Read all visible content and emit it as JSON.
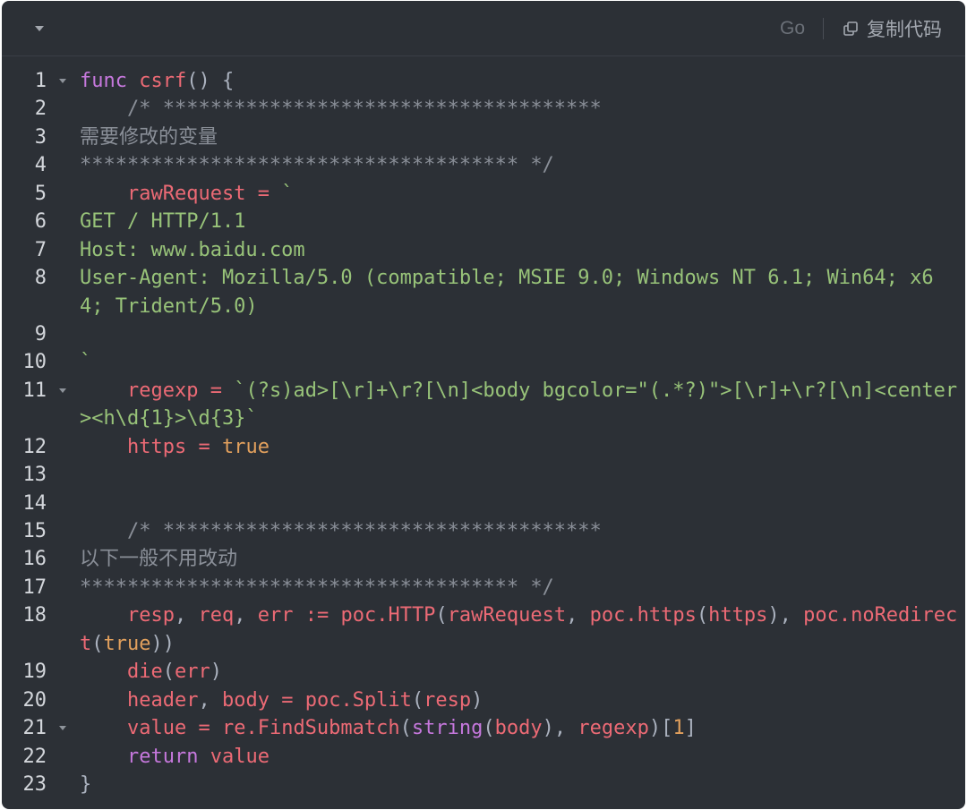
{
  "toolbar": {
    "collapse_icon": "chevron-down-icon",
    "language": "Go",
    "copy_icon": "copy-icon",
    "copy_label": "复制代码"
  },
  "fold_icon": "caret-down-icon",
  "colors": {
    "background": "#2c3036",
    "line_number": "#d3d6db",
    "fold_caret": "#8e939b"
  },
  "syntax_colors": {
    "keyword": "#c678dd",
    "builtin": "#c678dd",
    "identifier": "#ec6a75",
    "operator": "#ec6a75",
    "string": "#98c379",
    "comment": "#8a8f98",
    "punctuation": "#abb2bf",
    "literal": "#e2a05d",
    "plain": "#abb2bf"
  },
  "code": {
    "lines": [
      {
        "n": 1,
        "fold": true,
        "rows": [
          [
            {
              "keyword": "func"
            },
            {
              "plain": " "
            },
            {
              "identifier": "csrf"
            },
            {
              "punctuation": "() {"
            }
          ]
        ]
      },
      {
        "n": 2,
        "fold": false,
        "rows": [
          [
            {
              "comment": "    /* *************************************"
            }
          ]
        ]
      },
      {
        "n": 3,
        "fold": false,
        "rows": [
          [
            {
              "comment": "需要修改的变量"
            }
          ]
        ]
      },
      {
        "n": 4,
        "fold": false,
        "rows": [
          [
            {
              "comment": "************************************* */"
            }
          ]
        ]
      },
      {
        "n": 5,
        "fold": false,
        "rows": [
          [
            {
              "plain": "    "
            },
            {
              "identifier": "rawRequest"
            },
            {
              "plain": " "
            },
            {
              "operator": "="
            },
            {
              "plain": " "
            },
            {
              "string": "`"
            }
          ]
        ]
      },
      {
        "n": 6,
        "fold": false,
        "rows": [
          [
            {
              "string": "GET / HTTP/1.1"
            }
          ]
        ]
      },
      {
        "n": 7,
        "fold": false,
        "rows": [
          [
            {
              "string": "Host: www.baidu.com"
            }
          ]
        ]
      },
      {
        "n": 8,
        "fold": false,
        "rows": [
          [
            {
              "string": "User-Agent: Mozilla/5.0 (compatible; MSIE 9.0; Windows NT 6.1; Win64; x6"
            }
          ],
          [
            {
              "string": "4; Trident/5.0)"
            }
          ]
        ]
      },
      {
        "n": 9,
        "fold": false,
        "rows": [
          []
        ]
      },
      {
        "n": 10,
        "fold": false,
        "rows": [
          [
            {
              "string": "`"
            }
          ]
        ]
      },
      {
        "n": 11,
        "fold": true,
        "rows": [
          [
            {
              "plain": "    "
            },
            {
              "identifier": "regexp"
            },
            {
              "plain": " "
            },
            {
              "operator": "="
            },
            {
              "plain": " "
            },
            {
              "string": "`(?s)ad>[\\r]+\\r?[\\n]<body bgcolor=\"(.*?)\">[\\r]+\\r?[\\n]<center"
            }
          ],
          [
            {
              "string": "><h\\d{1}>\\d{3}`"
            }
          ]
        ]
      },
      {
        "n": 12,
        "fold": false,
        "rows": [
          [
            {
              "plain": "    "
            },
            {
              "identifier": "https"
            },
            {
              "plain": " "
            },
            {
              "operator": "="
            },
            {
              "plain": " "
            },
            {
              "literal": "true"
            }
          ]
        ]
      },
      {
        "n": 13,
        "fold": false,
        "rows": [
          []
        ]
      },
      {
        "n": 14,
        "fold": false,
        "rows": [
          []
        ]
      },
      {
        "n": 15,
        "fold": false,
        "rows": [
          [
            {
              "comment": "    /* *************************************"
            }
          ]
        ]
      },
      {
        "n": 16,
        "fold": false,
        "rows": [
          [
            {
              "comment": "以下一般不用改动"
            }
          ]
        ]
      },
      {
        "n": 17,
        "fold": false,
        "rows": [
          [
            {
              "comment": "************************************* */"
            }
          ]
        ]
      },
      {
        "n": 18,
        "fold": false,
        "rows": [
          [
            {
              "plain": "    "
            },
            {
              "identifier": "resp"
            },
            {
              "punctuation": ", "
            },
            {
              "identifier": "req"
            },
            {
              "punctuation": ", "
            },
            {
              "identifier": "err"
            },
            {
              "plain": " "
            },
            {
              "operator": ":="
            },
            {
              "plain": " "
            },
            {
              "identifier": "poc.HTTP"
            },
            {
              "punctuation": "("
            },
            {
              "identifier": "rawRequest"
            },
            {
              "punctuation": ", "
            },
            {
              "identifier": "poc.https"
            },
            {
              "punctuation": "("
            },
            {
              "identifier": "https"
            },
            {
              "punctuation": "), "
            },
            {
              "identifier": "poc.noRedirec"
            }
          ],
          [
            {
              "identifier": "t"
            },
            {
              "punctuation": "("
            },
            {
              "literal": "true"
            },
            {
              "punctuation": "))"
            }
          ]
        ]
      },
      {
        "n": 19,
        "fold": false,
        "rows": [
          [
            {
              "plain": "    "
            },
            {
              "identifier": "die"
            },
            {
              "punctuation": "("
            },
            {
              "identifier": "err"
            },
            {
              "punctuation": ")"
            }
          ]
        ]
      },
      {
        "n": 20,
        "fold": false,
        "rows": [
          [
            {
              "plain": "    "
            },
            {
              "identifier": "header"
            },
            {
              "punctuation": ", "
            },
            {
              "identifier": "body"
            },
            {
              "plain": " "
            },
            {
              "operator": "="
            },
            {
              "plain": " "
            },
            {
              "identifier": "poc.Split"
            },
            {
              "punctuation": "("
            },
            {
              "identifier": "resp"
            },
            {
              "punctuation": ")"
            }
          ]
        ]
      },
      {
        "n": 21,
        "fold": true,
        "rows": [
          [
            {
              "plain": "    "
            },
            {
              "identifier": "value"
            },
            {
              "plain": " "
            },
            {
              "operator": "="
            },
            {
              "plain": " "
            },
            {
              "identifier": "re.FindSubmatch"
            },
            {
              "punctuation": "("
            },
            {
              "builtin": "string"
            },
            {
              "punctuation": "("
            },
            {
              "identifier": "body"
            },
            {
              "punctuation": "), "
            },
            {
              "identifier": "regexp"
            },
            {
              "punctuation": ")["
            },
            {
              "literal": "1"
            },
            {
              "punctuation": "]"
            }
          ]
        ]
      },
      {
        "n": 22,
        "fold": false,
        "rows": [
          [
            {
              "plain": "    "
            },
            {
              "keyword": "return"
            },
            {
              "plain": " "
            },
            {
              "identifier": "value"
            }
          ]
        ]
      },
      {
        "n": 23,
        "fold": false,
        "rows": [
          [
            {
              "punctuation": "}"
            }
          ]
        ]
      }
    ]
  }
}
